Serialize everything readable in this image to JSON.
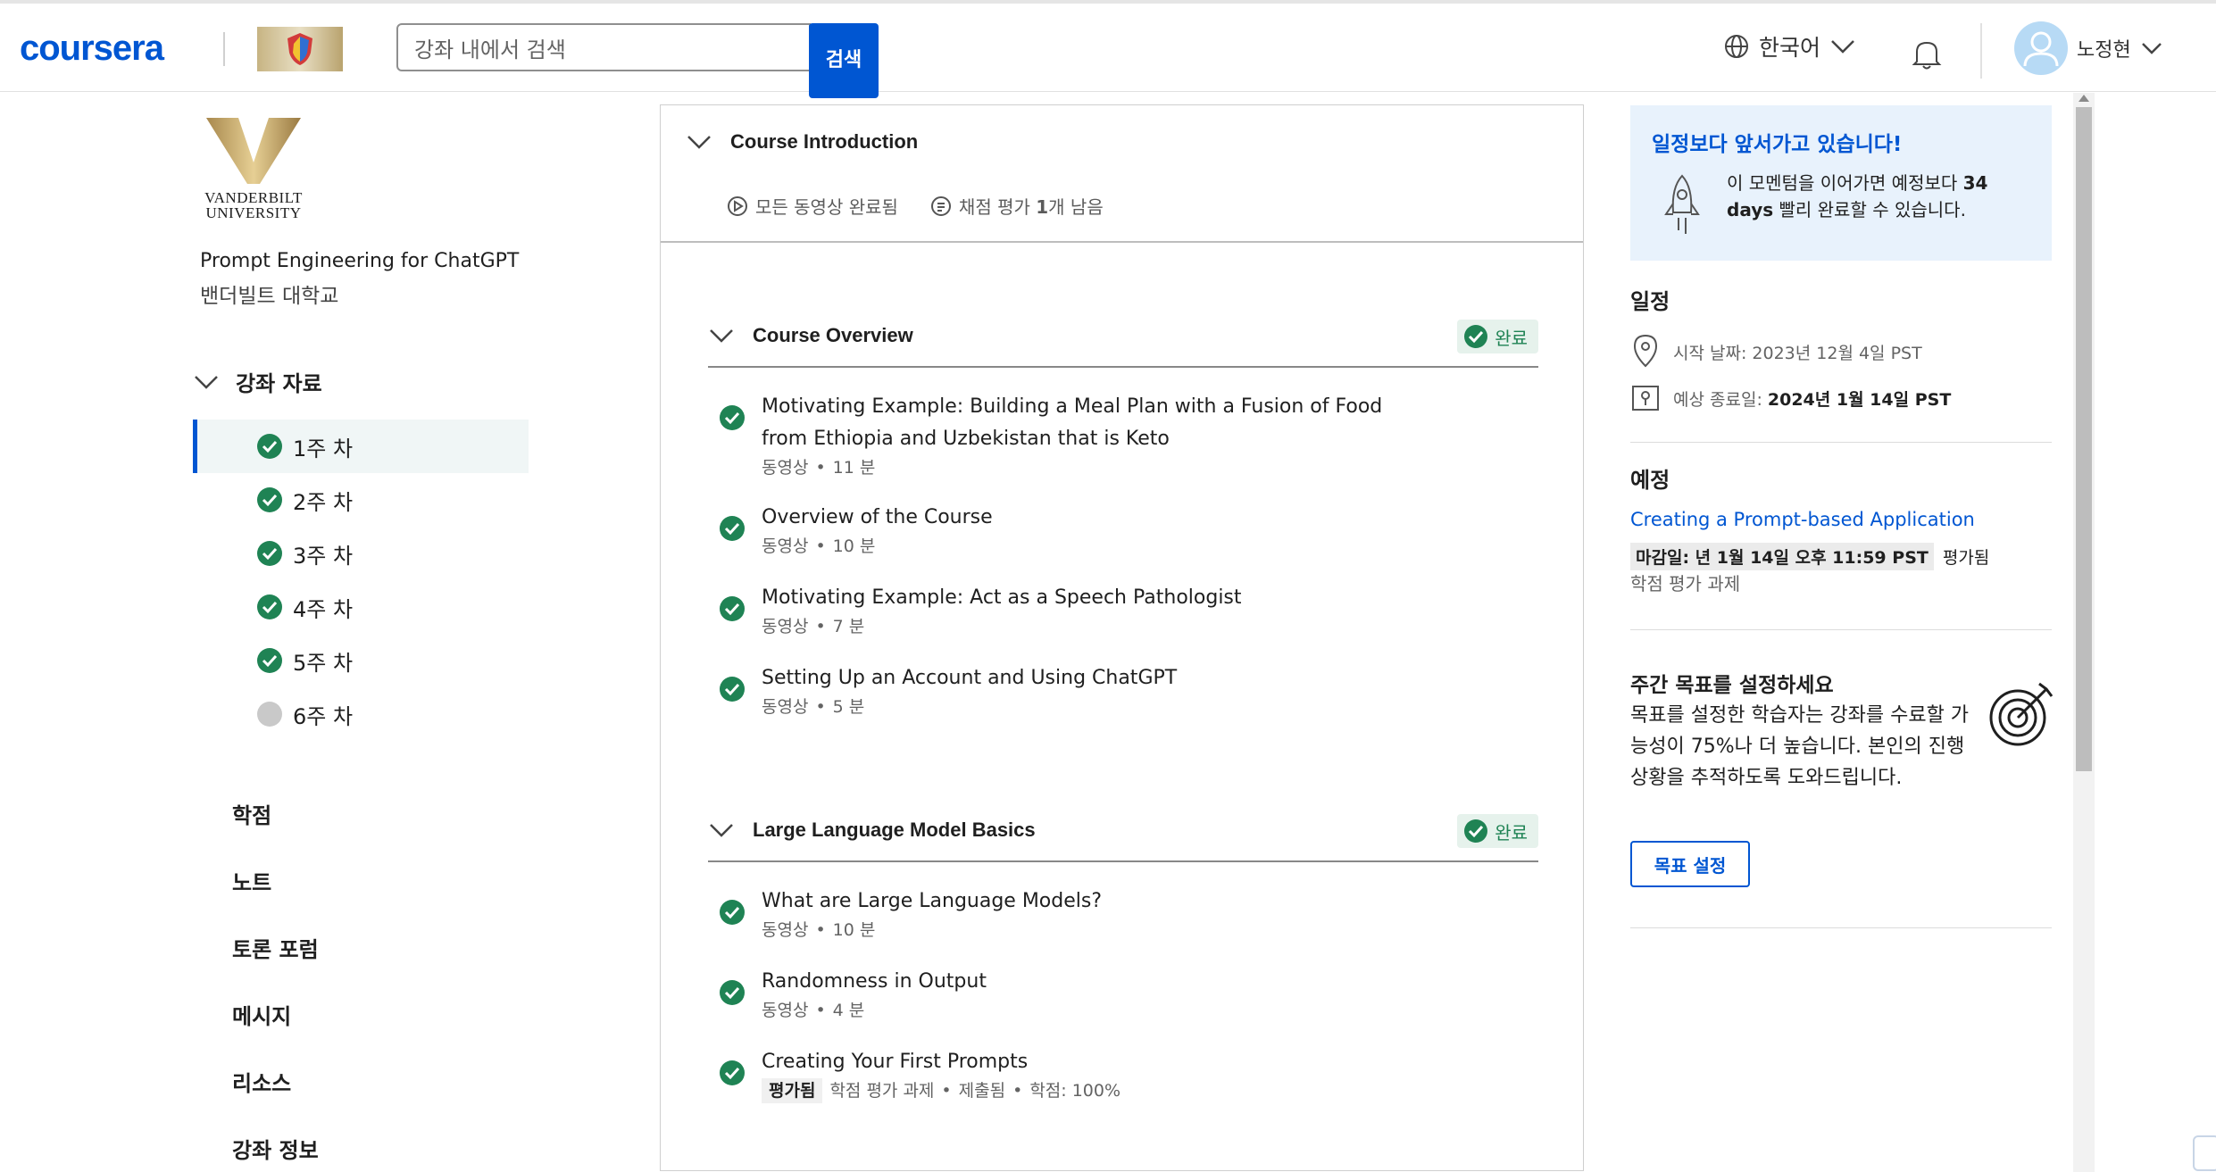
{
  "header": {
    "brand": "coursera",
    "search_placeholder": "강좌 내에서 검색",
    "search_button": "검색",
    "language": "한국어",
    "username": "노정현"
  },
  "left_nav": {
    "university_logo_text": "VANDERBILT UNIVERSITY",
    "course_title": "Prompt Engineering for ChatGPT",
    "course_university": "밴더빌트 대학교",
    "section_label": "강좌 자료",
    "weeks": [
      {
        "label": "1주 차",
        "done": true
      },
      {
        "label": "2주 차",
        "done": true
      },
      {
        "label": "3주 차",
        "done": true
      },
      {
        "label": "4주 차",
        "done": true
      },
      {
        "label": "5주 차",
        "done": true
      },
      {
        "label": "6주 차",
        "done": false
      }
    ],
    "links": [
      "학점",
      "노트",
      "토론 포럼",
      "메시지",
      "리소스",
      "강좌 정보"
    ]
  },
  "main": {
    "intro_title": "Course Introduction",
    "intro_videos": "모든 동영상 완료됨",
    "intro_assess_prefix": "채점 평가 ",
    "intro_assess_count": "1",
    "intro_assess_suffix": "개 남음",
    "modules": [
      {
        "title": "Course Overview",
        "badge": "완료",
        "items": [
          {
            "title_1": "Motivating Example: Building a Meal Plan with a Fusion of Food",
            "title_2": "from Ethiopia and Uzbekistan that is Keto",
            "type": "동영상",
            "dur": "11 분"
          },
          {
            "title_1": "Overview of the Course",
            "type": "동영상",
            "dur": "10 분"
          },
          {
            "title_1": "Motivating Example: Act as a Speech Pathologist",
            "type": "동영상",
            "dur": "7 분"
          },
          {
            "title_1": "Setting Up an Account and Using ChatGPT",
            "type": "동영상",
            "dur": "5 분"
          }
        ]
      },
      {
        "title": "Large Language Model Basics",
        "badge": "완료",
        "items": [
          {
            "title_1": "What are Large Language Models?",
            "type": "동영상",
            "dur": "10 분"
          },
          {
            "title_1": "Randomness in Output",
            "type": "동영상",
            "dur": "4 분"
          },
          {
            "title_1": "Creating Your First Prompts",
            "graded": "평가됨",
            "type": "학점 평가 과제",
            "status": "제출됨",
            "score": "학점: 100%"
          }
        ]
      }
    ]
  },
  "right": {
    "ahead_title": "일정보다 앞서가고 있습니다!",
    "ahead_text_1": "이 모멘텀을 이어가면 예정보다 ",
    "ahead_days": "34 days",
    "ahead_text_2": " 빨리 완료할 수 있습니다.",
    "schedule_title": "일정",
    "start_label": "시작 날짜: 2023년 12월 4일 PST",
    "end_label": "예상 종료일: ",
    "end_value": "2024년 1월 14일 PST",
    "upcoming_title": "예정",
    "upcoming_link": "Creating a Prompt-based Application",
    "upcoming_due": "마감일: 년 1월 14일 오후 11:59 PST",
    "upcoming_graded": "평가됨",
    "upcoming_type": "학점 평가 과제",
    "goal_title": "주간 목표를 설정하세요",
    "goal_text": "목표를 설정한 학습자는 강좌를 수료할 가능성이 75%나 더 높습니다. 본인의 진행 상황을 추적하도록 도와드립니다.",
    "goal_button": "목표 설정"
  },
  "colors": {
    "brand": "#0056d2",
    "success": "#1f8354",
    "ahead_bg": "#e8f2fc"
  }
}
